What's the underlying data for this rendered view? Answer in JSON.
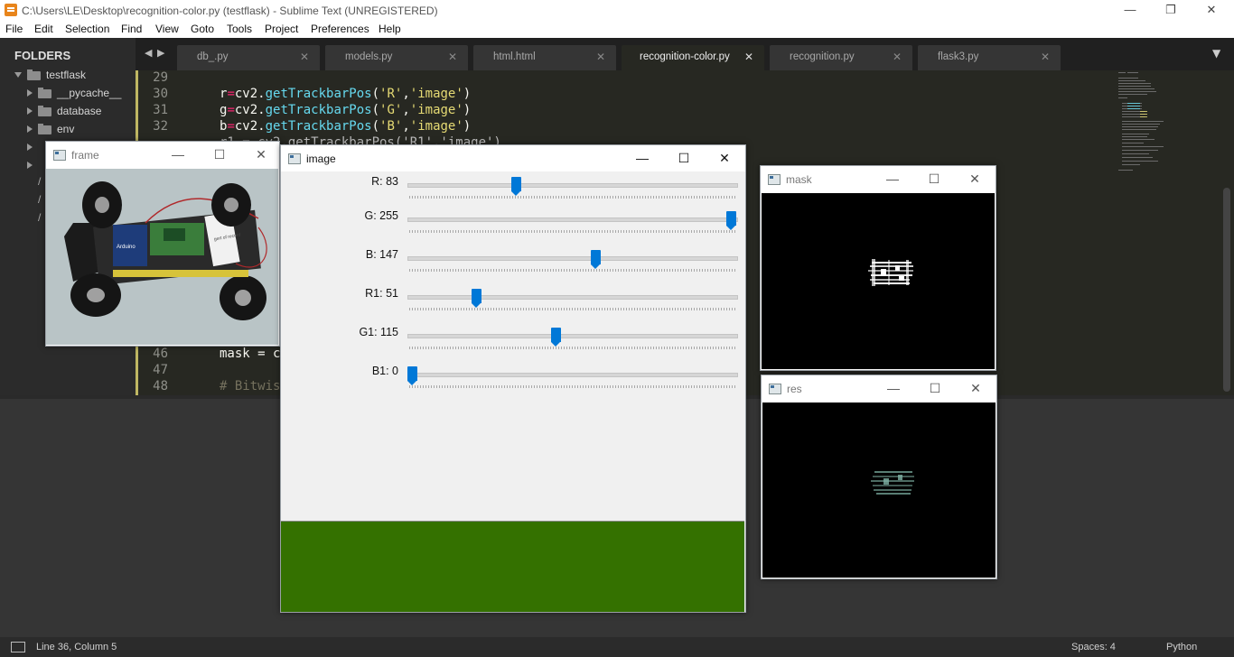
{
  "titlebar": {
    "title": "C:\\Users\\LE\\Desktop\\recognition-color.py (testflask) - Sublime Text (UNREGISTERED)",
    "minimize": "—",
    "maximize": "❐",
    "close": "✕"
  },
  "menu": [
    "File",
    "Edit",
    "Selection",
    "Find",
    "View",
    "Goto",
    "Tools",
    "Project",
    "Preferences",
    "Help"
  ],
  "sidebar": {
    "header": "FOLDERS",
    "root": "testflask",
    "items": [
      "__pycache__",
      "database",
      "env"
    ],
    "nav_left": "◀",
    "nav_right": "▶"
  },
  "tabs": [
    {
      "label": "db_.py",
      "close": "✕"
    },
    {
      "label": "models.py",
      "close": "✕"
    },
    {
      "label": "html.html",
      "close": "✕"
    },
    {
      "label": "recognition-color.py",
      "close": "✕"
    },
    {
      "label": "recognition.py",
      "close": "✕"
    },
    {
      "label": "flask3.py",
      "close": "✕"
    }
  ],
  "tab_overflow": "▼",
  "editor": {
    "lines": [
      {
        "num": "29"
      },
      {
        "num": "30",
        "pre": "r",
        "eq": "=",
        "mid": "cv2.",
        "fn": "getTrackbarPos",
        "open": "(",
        "s1": "'R'",
        "comma": ",",
        "s2": "'image'",
        "close": ")"
      },
      {
        "num": "31",
        "pre": "g",
        "eq": "=",
        "mid": "cv2.",
        "fn": "getTrackbarPos",
        "open": "(",
        "s1": "'G'",
        "comma": ",",
        "s2": "'image'",
        "close": ")"
      },
      {
        "num": "32",
        "pre": "b",
        "eq": "=",
        "mid": "cv2.",
        "fn": "getTrackbarPos",
        "open": "(",
        "s1": "'B'",
        "comma": ",",
        "s2": "'image'",
        "close": ")"
      },
      {
        "num": "33",
        "partial": "r1 = cv2.getTrackbarPos('R1','image')"
      },
      {
        "num": "46",
        "code": "mask = c"
      },
      {
        "num": "47"
      },
      {
        "num": "48",
        "comment": "# Bitwis"
      }
    ],
    "sidebar_paths": [
      "/",
      "/",
      "/"
    ]
  },
  "status": {
    "position": "Line 36, Column 5",
    "spaces": "Spaces: 4",
    "syntax": "Python"
  },
  "frame_window": {
    "title": "frame",
    "minimize": "—",
    "maximize": "☐",
    "close": "✕",
    "board_label": "Arduino",
    "card_label": "gert of record"
  },
  "image_window": {
    "title": "image",
    "minimize": "—",
    "maximize": "☐",
    "close": "✕",
    "sliders": [
      {
        "label": "R: 83",
        "value": 83,
        "max": 255
      },
      {
        "label": "G: 255",
        "value": 255,
        "max": 255
      },
      {
        "label": "B: 147",
        "value": 147,
        "max": 255
      },
      {
        "label": "R1: 51",
        "value": 51,
        "max": 255
      },
      {
        "label": "G1: 115",
        "value": 115,
        "max": 255
      },
      {
        "label": "B1: 0",
        "value": 0,
        "max": 255
      }
    ],
    "preview_color": "#347100"
  },
  "mask_window": {
    "title": "mask",
    "minimize": "—",
    "maximize": "☐",
    "close": "✕"
  },
  "res_window": {
    "title": "res",
    "minimize": "—",
    "maximize": "☐",
    "close": "✕"
  },
  "colors": {
    "editor_bg": "#272822",
    "function": "#66d9ef",
    "string": "#e6db74",
    "operator": "#f92672",
    "accent_thumb": "#0078d7"
  }
}
